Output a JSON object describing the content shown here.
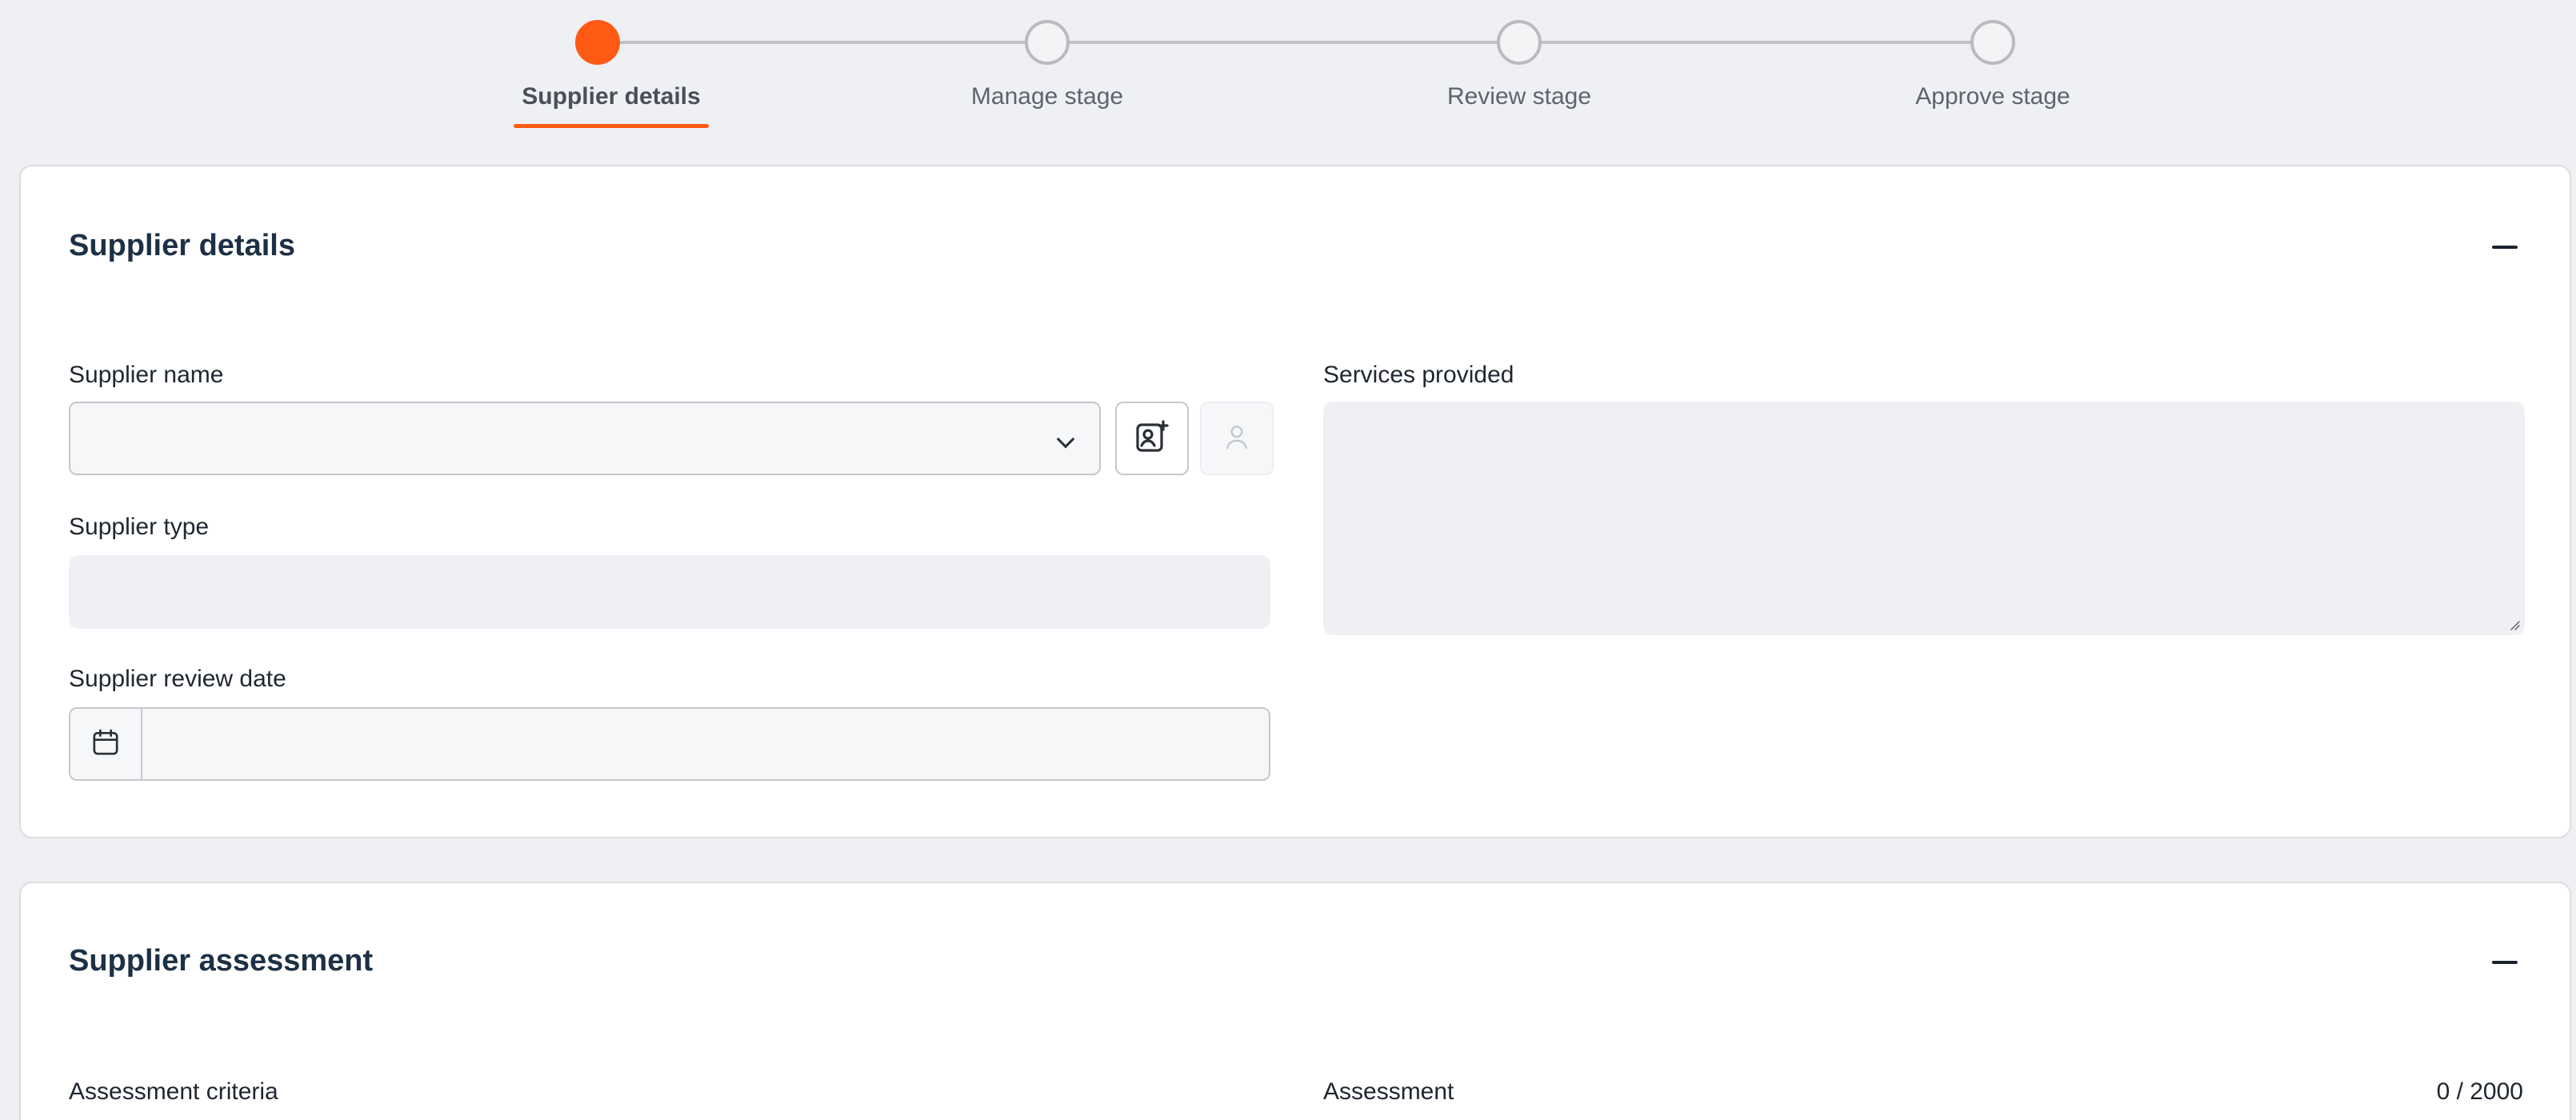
{
  "stepper": {
    "steps": [
      {
        "label": "Supplier details",
        "active": true
      },
      {
        "label": "Manage stage",
        "active": false
      },
      {
        "label": "Review stage",
        "active": false
      },
      {
        "label": "Approve stage",
        "active": false
      }
    ],
    "accent_color": "#ff5a14"
  },
  "supplier_details": {
    "title": "Supplier details",
    "supplier_name_label": "Supplier name",
    "supplier_type_label": "Supplier type",
    "review_date_label": "Supplier review date",
    "services_label": "Services provided"
  },
  "supplier_assessment": {
    "title": "Supplier assessment",
    "criteria_label": "Assessment criteria",
    "assessment_label": "Assessment",
    "assessment_counter": "0 / 2000"
  },
  "icons": {
    "add_contact": "add-contact-icon",
    "user": "user-icon",
    "calendar": "calendar-icon",
    "chevron": "chevron-down-icon",
    "collapse": "minus-icon"
  }
}
